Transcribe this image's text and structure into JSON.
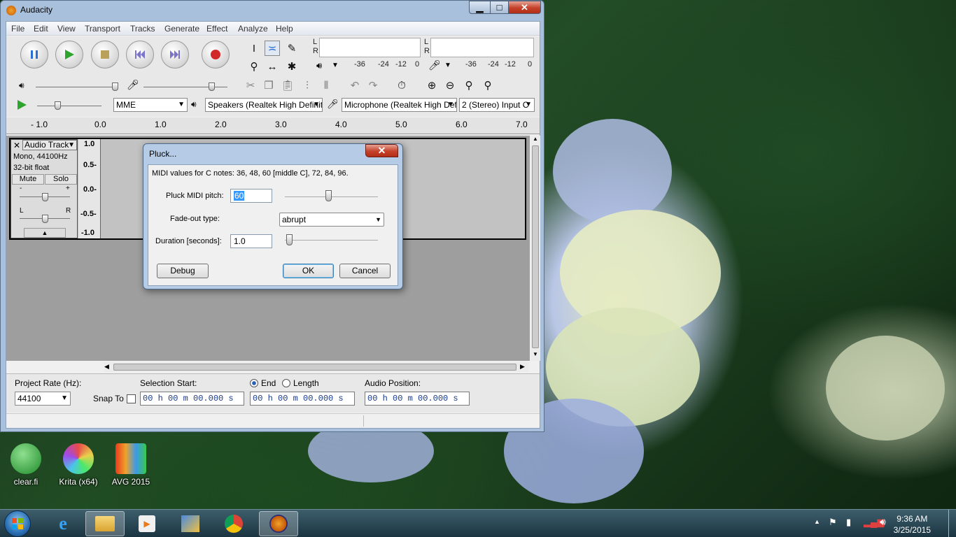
{
  "window": {
    "title": "Audacity",
    "minimize": "▁",
    "maximize": "□",
    "close": "✕"
  },
  "menu": [
    "File",
    "Edit",
    "View",
    "Transport",
    "Tracks",
    "Generate",
    "Effect",
    "Analyze",
    "Help"
  ],
  "meters": {
    "left": "L",
    "right": "R",
    "ticks": [
      "-36",
      "-24",
      "-12",
      "0"
    ]
  },
  "devices": {
    "host": "MME",
    "output": "Speakers (Realtek High Definit",
    "input": "Microphone (Realtek High Defi",
    "channels": "2 (Stereo) Input C"
  },
  "ruler": [
    "- 1.0",
    "0.0",
    "1.0",
    "2.0",
    "3.0",
    "4.0",
    "5.0",
    "6.0",
    "7.0"
  ],
  "track": {
    "name": "Audio Track",
    "info1": "Mono, 44100Hz",
    "info2": "32-bit float",
    "mute": "Mute",
    "solo": "Solo",
    "gain_l": "-",
    "gain_r": "+",
    "pan_l": "L",
    "pan_r": "R",
    "scale": [
      "1.0",
      "0.5-",
      "0.0-",
      "-0.5-",
      "-1.0"
    ]
  },
  "selection": {
    "project_rate_label": "Project Rate (Hz):",
    "project_rate": "44100",
    "snap_label": "Snap To",
    "sel_start_label": "Selection Start:",
    "end_label": "End",
    "length_label": "Length",
    "audio_pos_label": "Audio Position:",
    "time_value": "00 h 00 m 00.000 s"
  },
  "dialog": {
    "title": "Pluck...",
    "info": "MIDI values for C notes: 36, 48, 60 [middle C], 72, 84, 96.",
    "pitch_label": "Pluck MIDI pitch:",
    "pitch_value": "60",
    "pitch_slider": 0.47,
    "fade_label": "Fade-out type:",
    "fade_value": "abrupt",
    "duration_label": "Duration [seconds]:",
    "duration_value": "1.0",
    "duration_slider": 0.02,
    "debug": "Debug",
    "ok": "OK",
    "cancel": "Cancel",
    "close": "✕"
  },
  "desktop_icons": [
    {
      "label": "clear.fi",
      "color": "#2fae3a"
    },
    {
      "label": "Krita (x64)",
      "color": "#c05ac8"
    },
    {
      "label": "AVG 2015",
      "color": "#e87a1c"
    }
  ],
  "taskbar": {
    "time": "9:36 AM",
    "date": "3/25/2015"
  }
}
